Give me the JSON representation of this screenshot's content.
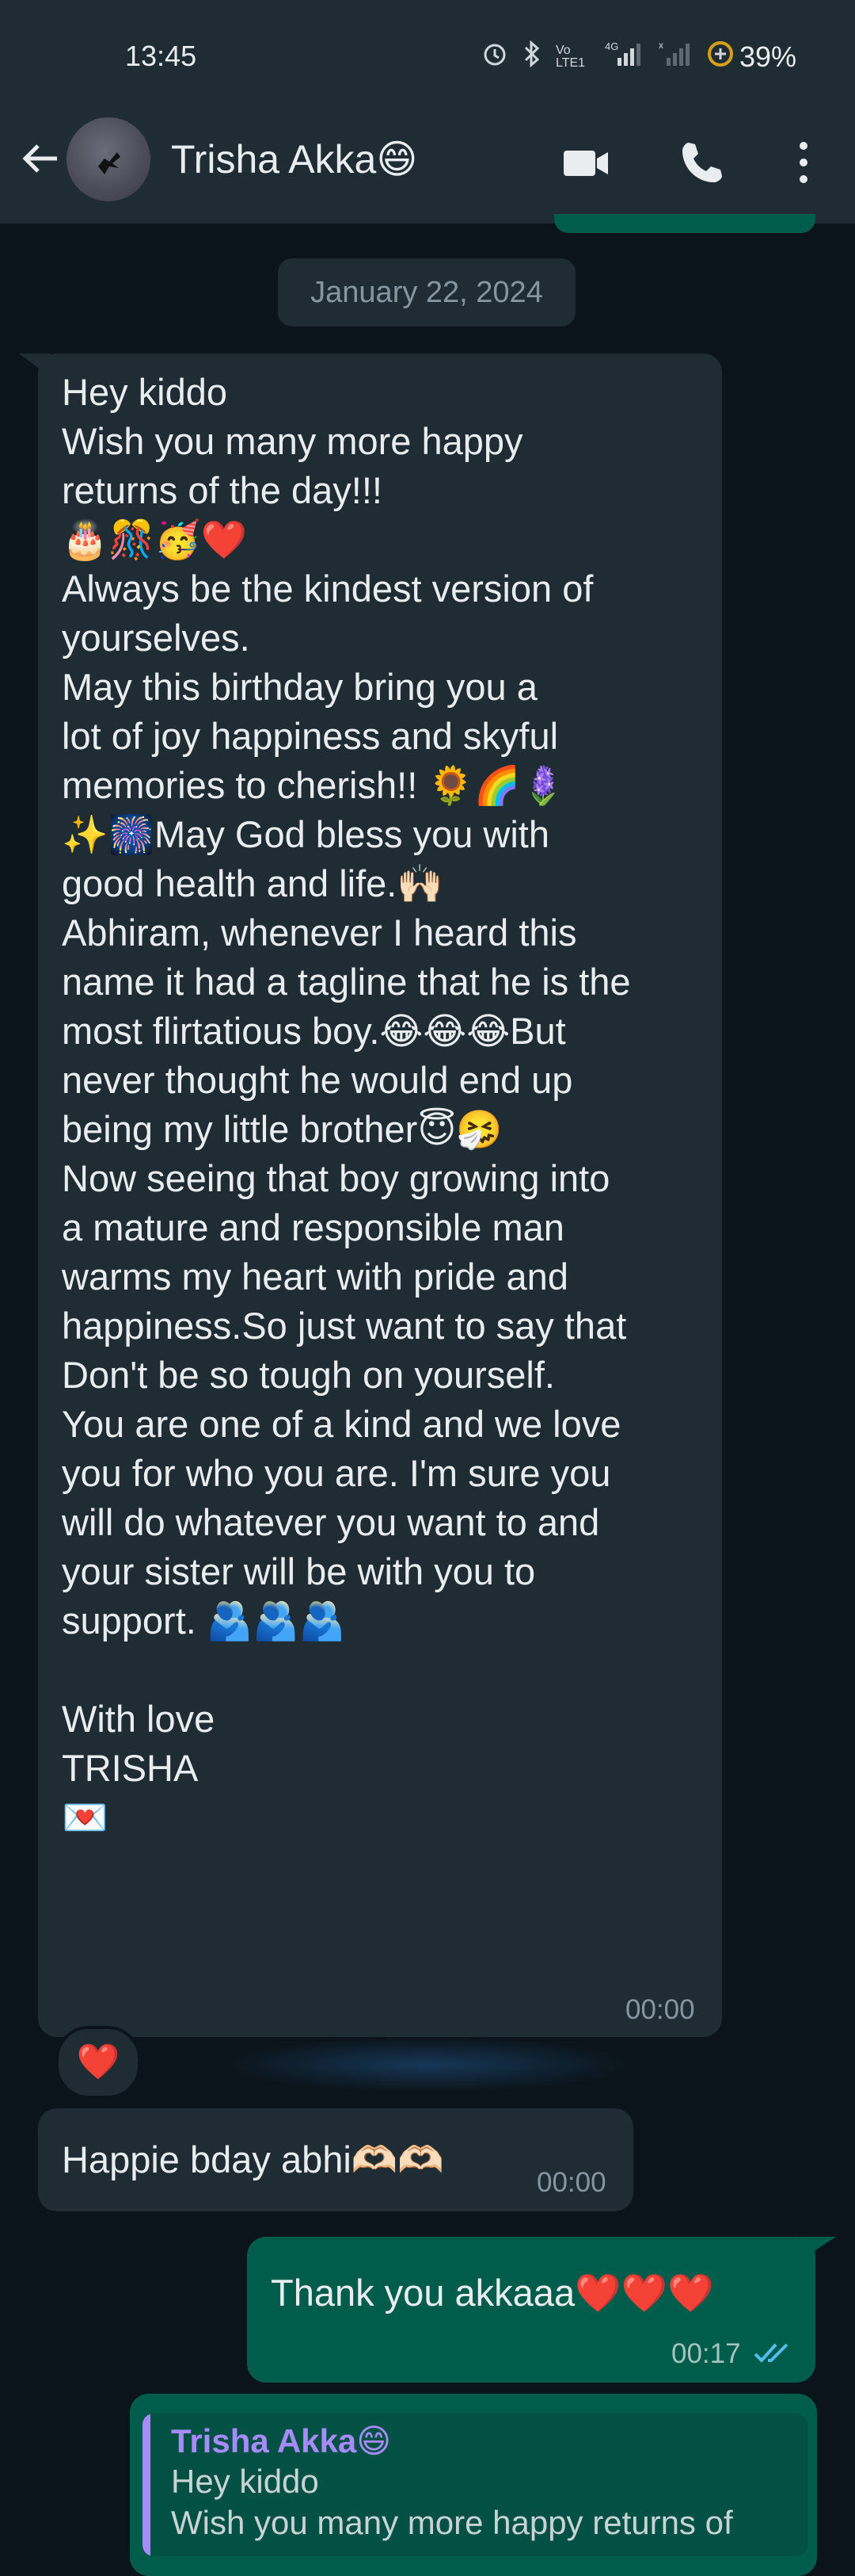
{
  "status": {
    "time": "13:45",
    "battery": "39%",
    "icons": [
      "alarm-icon",
      "bluetooth-icon",
      "volte-icon",
      "signal-4g-icon",
      "signal-icon",
      "battery-saver-icon"
    ],
    "volte_label": "Vo LTE1",
    "net_label": "4G"
  },
  "header": {
    "contact_name": "Trisha Akka😄",
    "icons": [
      "back-arrow-icon",
      "video-call-icon",
      "voice-call-icon",
      "more-options-icon"
    ]
  },
  "chat": {
    "date_chip": "January 22, 2024",
    "long_message": {
      "lines": [
        "Hey kiddo",
        "Wish you many more happy",
        "returns of the day!!!",
        "🎂🎊🥳❤️",
        "Always be the kindest version of",
        "yourselves.",
        "May this birthday bring you a",
        "lot of joy happiness and skyful",
        "memories to cherish!! 🌻🌈🪻",
        "✨🎆May God bless you with",
        "good health and life.🙌🏻",
        "Abhiram, whenever I heard this",
        "name it had a tagline that he is the",
        "most flirtatious boy.😂😂😂But",
        "never thought he would end up",
        "being my little brother😇🤧",
        "Now seeing that boy growing into",
        "a mature and responsible man",
        "warms my heart with pride and",
        "happiness.So just want to say that",
        "Don't be so tough on yourself.",
        "You are one of a kind and we love",
        "you for who you are. I'm sure you",
        "will do whatever you want to and",
        "your sister will be with you to",
        "support. 🫂🫂🫂",
        "",
        "With love",
        "TRISHA",
        "💌"
      ],
      "time": "00:00",
      "reaction": "❤️"
    },
    "short_message": {
      "text": "Happie bday abhi🫶🏻🫶🏻",
      "time": "00:00"
    },
    "sent_message": {
      "text": "Thank you akkaaa❤️❤️❤️",
      "time": "00:17",
      "status_icon": "double-check-read-icon",
      "check_color": "#53bdeb"
    },
    "reply_message": {
      "quoted_author": "Trisha Akka😄",
      "quoted_lines": [
        "Hey kiddo",
        "Wish you many more happy returns of"
      ]
    }
  },
  "colors": {
    "background": "#0b141a",
    "header": "#1f2c34",
    "incoming_bubble": "#1f2c34",
    "outgoing_bubble": "#005c4b",
    "quote_accent": "#a78bfa"
  }
}
